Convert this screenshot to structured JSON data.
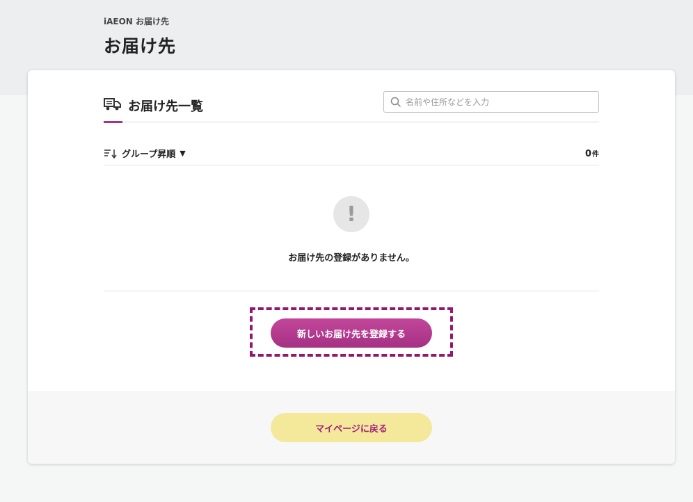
{
  "header": {
    "breadcrumb": "iAEON お届け先",
    "title": "お届け先"
  },
  "section": {
    "icon": "delivery-truck-icon",
    "title": "お届け先一覧"
  },
  "search": {
    "placeholder": "名前や住所などを入力",
    "value": "",
    "icon": "search-icon"
  },
  "sort": {
    "icon": "sort-icon",
    "label": "グループ昇順",
    "caret": "▼",
    "count": "0",
    "count_unit": "件"
  },
  "empty_state": {
    "icon": "exclamation-icon",
    "symbol": "!",
    "message": "お届け先の登録がありません。"
  },
  "buttons": {
    "register": "新しいお届け先を登録する",
    "back": "マイページに戻る"
  },
  "colors": {
    "accent": "#a8318a",
    "primary_button": "#b73d90",
    "back_button": "#f4e89a",
    "highlight_dash": "#94176e"
  }
}
